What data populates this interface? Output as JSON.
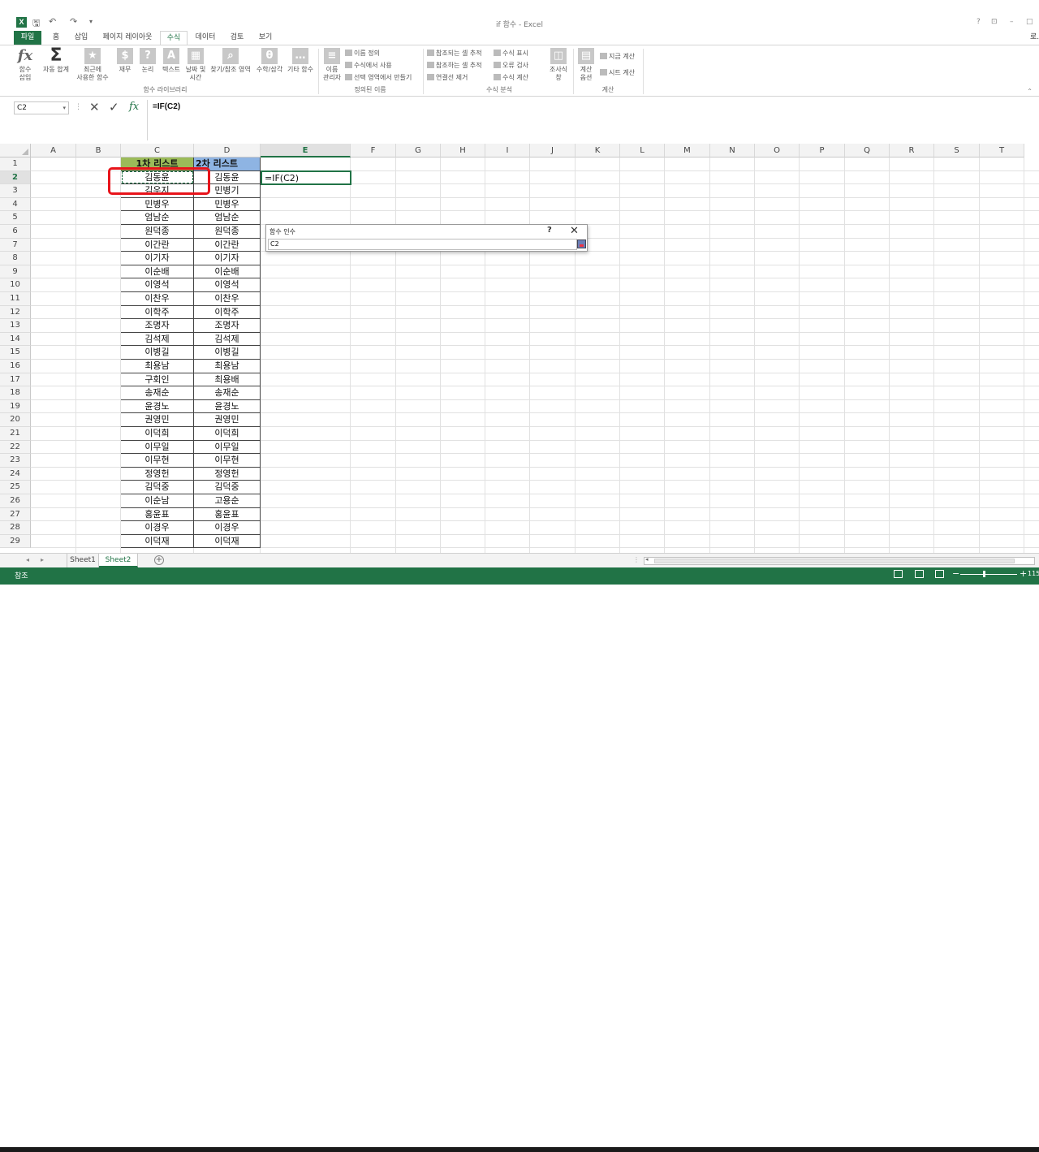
{
  "window": {
    "title": "if 함수 - Excel",
    "user_partial": "로.",
    "help": "?",
    "restore": "⊡",
    "minimize": "–",
    "maximize": "□"
  },
  "qat": {
    "save": "🖫",
    "undo": "↶",
    "redo": "↷",
    "customize": "▾"
  },
  "tabs": [
    "파일",
    "홈",
    "삽입",
    "페이지 레이아웃",
    "수식",
    "데이터",
    "검토",
    "보기"
  ],
  "active_tab": "수식",
  "ribbon": {
    "insert_function": "함수\n삽입",
    "autosum": "자동 합계",
    "recent": "최근에\n사용한 함수",
    "financial": "재무",
    "logical": "논리",
    "text": "텍스트",
    "datetime": "날짜 및\n시간",
    "lookup": "찾기/참조 영역",
    "math": "수학/삼각",
    "more": "기타 함수",
    "group_library": "함수 라이브러리",
    "name_manager": "이름\n관리자",
    "define_name": "이름 정의",
    "use_in_formula": "수식에서 사용",
    "create_from_selection": "선택 영역에서 만들기",
    "group_names": "정의된 이름",
    "trace_precedents": "참조되는 셀 추적",
    "trace_dependents": "참조하는 셀 추적",
    "remove_arrows": "연결선 제거",
    "show_formulas": "수식 표시",
    "error_checking": "오류 검사",
    "evaluate_formula": "수식 계산",
    "watch_window": "조사식\n창",
    "group_auditing": "수식 분석",
    "calc_options": "계산\n옵션",
    "calc_now": "지금 계산",
    "calc_sheet": "시트 계산",
    "group_calculation": "계산"
  },
  "formula_bar": {
    "name_box": "C2",
    "formula": "=IF(C2)",
    "cancel": "✕",
    "enter": "✓",
    "fx": "fx",
    "dots": "⋮"
  },
  "columns": [
    "A",
    "B",
    "C",
    "D",
    "E",
    "F",
    "G",
    "H",
    "I",
    "J",
    "K",
    "L",
    "M",
    "N",
    "O",
    "P",
    "Q",
    "R",
    "S",
    "T"
  ],
  "selected_column": "E",
  "header_row": {
    "c": "1차 리스트",
    "d": "2차 리스트"
  },
  "active_cell_text": "=IF(C2)",
  "rows": [
    [
      "김동윤",
      "김동윤"
    ],
    [
      "김우지",
      "민병기"
    ],
    [
      "민병우",
      "민병우"
    ],
    [
      "엄남순",
      "엄남순"
    ],
    [
      "원덕종",
      "원덕종"
    ],
    [
      "이간란",
      "이간란"
    ],
    [
      "이기자",
      "이기자"
    ],
    [
      "이순배",
      "이순배"
    ],
    [
      "이영석",
      "이영석"
    ],
    [
      "이찬우",
      "이찬우"
    ],
    [
      "이학주",
      "이학주"
    ],
    [
      "조명자",
      "조명자"
    ],
    [
      "김석제",
      "김석제"
    ],
    [
      "이병길",
      "이병길"
    ],
    [
      "최용남",
      "최용남"
    ],
    [
      "구회인",
      "최용배"
    ],
    [
      "송재순",
      "송재순"
    ],
    [
      "윤경노",
      "윤경노"
    ],
    [
      "권영민",
      "권영민"
    ],
    [
      "이덕희",
      "이덕희"
    ],
    [
      "이무일",
      "이무일"
    ],
    [
      "이무현",
      "이무현"
    ],
    [
      "정영헌",
      "정영헌"
    ],
    [
      "김덕중",
      "김덕중"
    ],
    [
      "이순남",
      "고용순"
    ],
    [
      "홍윤표",
      "홍윤표"
    ],
    [
      "이경우",
      "이경우"
    ],
    [
      "이덕재",
      "이덕재"
    ]
  ],
  "dialog": {
    "title": "함수 인수",
    "help": "?",
    "close": "✕",
    "value": "C2"
  },
  "sheets": [
    "Sheet1",
    "Sheet2"
  ],
  "active_sheet": "Sheet2",
  "add_sheet": "+",
  "nav_prev": "◂",
  "nav_next": "▸",
  "status": {
    "mode": "참조",
    "zoom": "115",
    "zoom_minus": "−",
    "zoom_plus": "+"
  },
  "accent": "#217346",
  "highlight_box_color": "#e8141b"
}
